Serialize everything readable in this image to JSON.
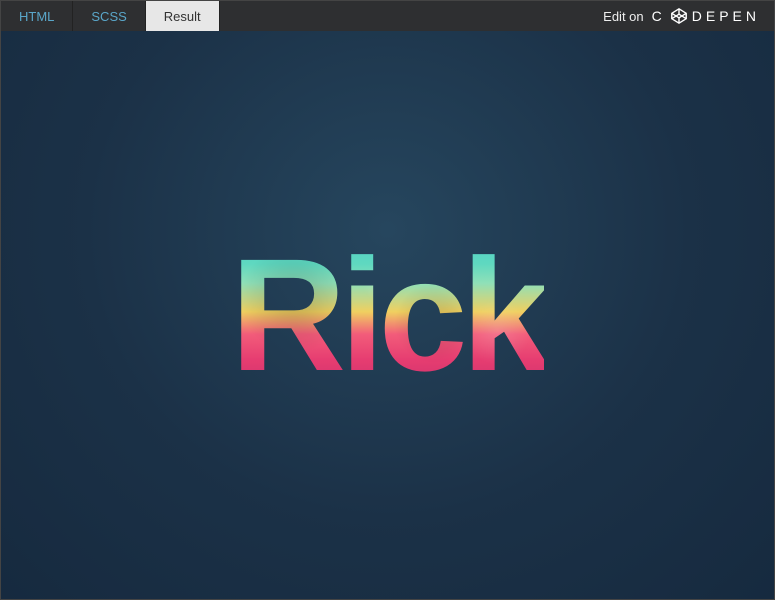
{
  "tabs": {
    "html": "HTML",
    "scss": "SCSS",
    "result": "Result",
    "active": "result"
  },
  "editon": {
    "label": "Edit on",
    "brand_left": "C",
    "brand_right": "DEPEN"
  },
  "preview": {
    "headline": "Rick"
  },
  "colors": {
    "topbar": "#2e2f31",
    "preview_bg": "#1e3a52",
    "tab_link": "#5aa6c9",
    "tab_active_bg": "#e7e7e7"
  }
}
